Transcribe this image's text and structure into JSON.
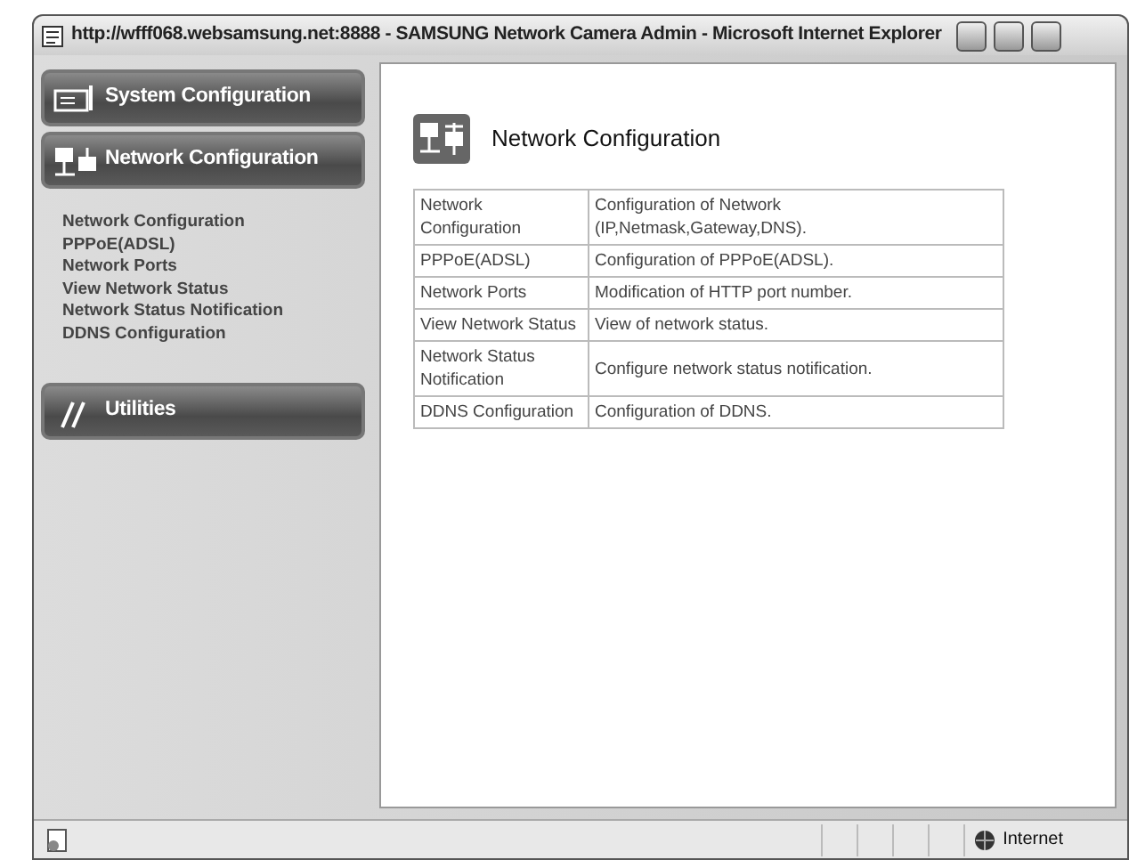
{
  "window": {
    "title": "http://wfff068.websamsung.net:8888 - SAMSUNG Network Camera Admin - Microsoft Internet Explorer"
  },
  "sidebar": {
    "sections": [
      {
        "label": "System Configuration",
        "kind": "system"
      },
      {
        "label": "Network Configuration",
        "kind": "network",
        "items": [
          "Network Configuration",
          "PPPoE(ADSL)",
          "Network Ports",
          "View Network Status",
          "Network Status Notification",
          "DDNS Configuration"
        ]
      },
      {
        "label": "Utilities",
        "kind": "utilities"
      }
    ]
  },
  "main": {
    "heading": "Network Configuration",
    "table": {
      "rows": [
        {
          "name": "Network Configuration",
          "description": "Configuration of Network (IP,Netmask,Gateway,DNS)."
        },
        {
          "name": "PPPoE(ADSL)",
          "description": "Configuration of PPPoE(ADSL)."
        },
        {
          "name": "Network Ports",
          "description": "Modification of HTTP port number."
        },
        {
          "name": "View Network Status",
          "description": "View of network status."
        },
        {
          "name": "Network Status Notification",
          "description": "Configure network status notification."
        },
        {
          "name": "DDNS Configuration",
          "description": "Configuration of DDNS."
        }
      ]
    }
  },
  "status_bar": {
    "zone": "Internet"
  }
}
